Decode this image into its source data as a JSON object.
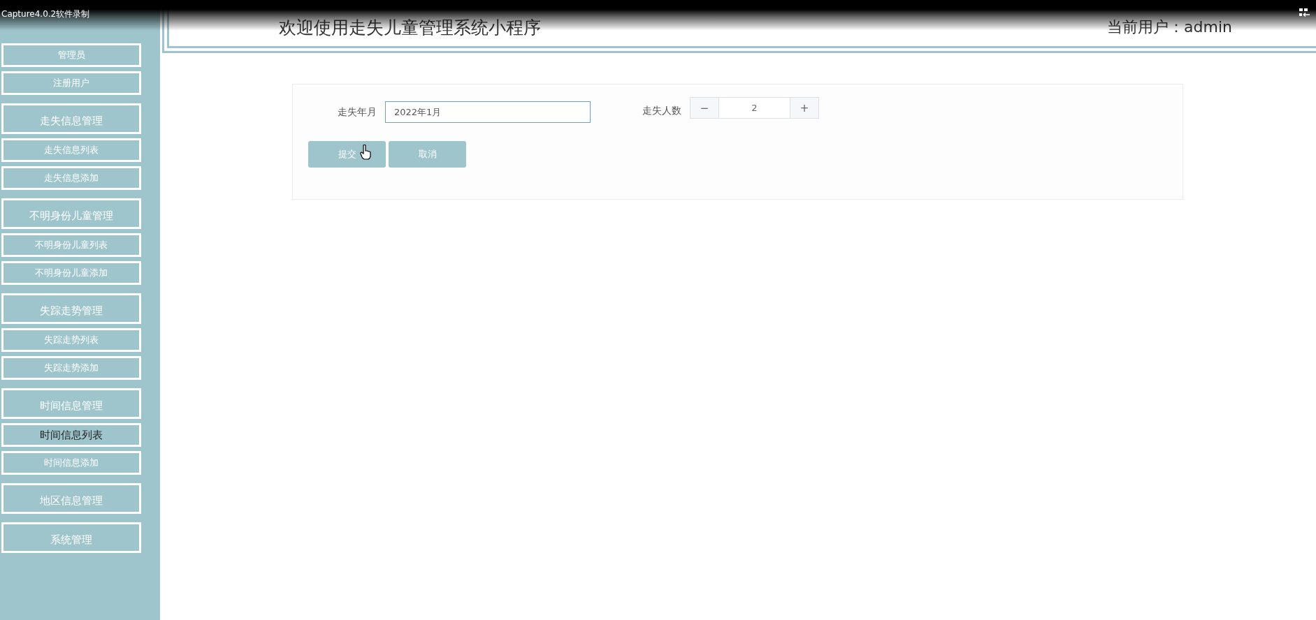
{
  "recorder_bar": {
    "title": "Capture4.0.2软件录制"
  },
  "sidebar": {
    "items": [
      {
        "kind": "sub",
        "label": "管理员",
        "selected": false
      },
      {
        "kind": "sub",
        "label": "注册用户",
        "selected": false
      },
      {
        "kind": "heading",
        "label": "走失信息管理",
        "selected": false
      },
      {
        "kind": "sub",
        "label": "走失信息列表",
        "selected": false
      },
      {
        "kind": "sub",
        "label": "走失信息添加",
        "selected": false
      },
      {
        "kind": "heading",
        "label": "不明身份儿童管理",
        "selected": false
      },
      {
        "kind": "sub",
        "label": "不明身份儿童列表",
        "selected": false
      },
      {
        "kind": "sub",
        "label": "不明身份儿童添加",
        "selected": false
      },
      {
        "kind": "heading",
        "label": "失踪走势管理",
        "selected": false
      },
      {
        "kind": "sub",
        "label": "失踪走势列表",
        "selected": false
      },
      {
        "kind": "sub",
        "label": "失踪走势添加",
        "selected": false
      },
      {
        "kind": "heading",
        "label": "时间信息管理",
        "selected": false
      },
      {
        "kind": "sub",
        "label": "时间信息列表",
        "selected": true
      },
      {
        "kind": "sub",
        "label": "时间信息添加",
        "selected": false
      },
      {
        "kind": "heading",
        "label": "地区信息管理",
        "selected": false
      },
      {
        "kind": "heading",
        "label": "系统管理",
        "selected": false
      }
    ]
  },
  "header": {
    "title": "欢迎使用走失儿童管理系统小程序",
    "user": "当前用户：admin"
  },
  "form": {
    "date_label": "走失年月",
    "date_value": "2022年1月",
    "count_label": "走失人数",
    "count_value": "2",
    "minus": "−",
    "plus": "+",
    "buttons": [
      "提交",
      "取消"
    ]
  }
}
